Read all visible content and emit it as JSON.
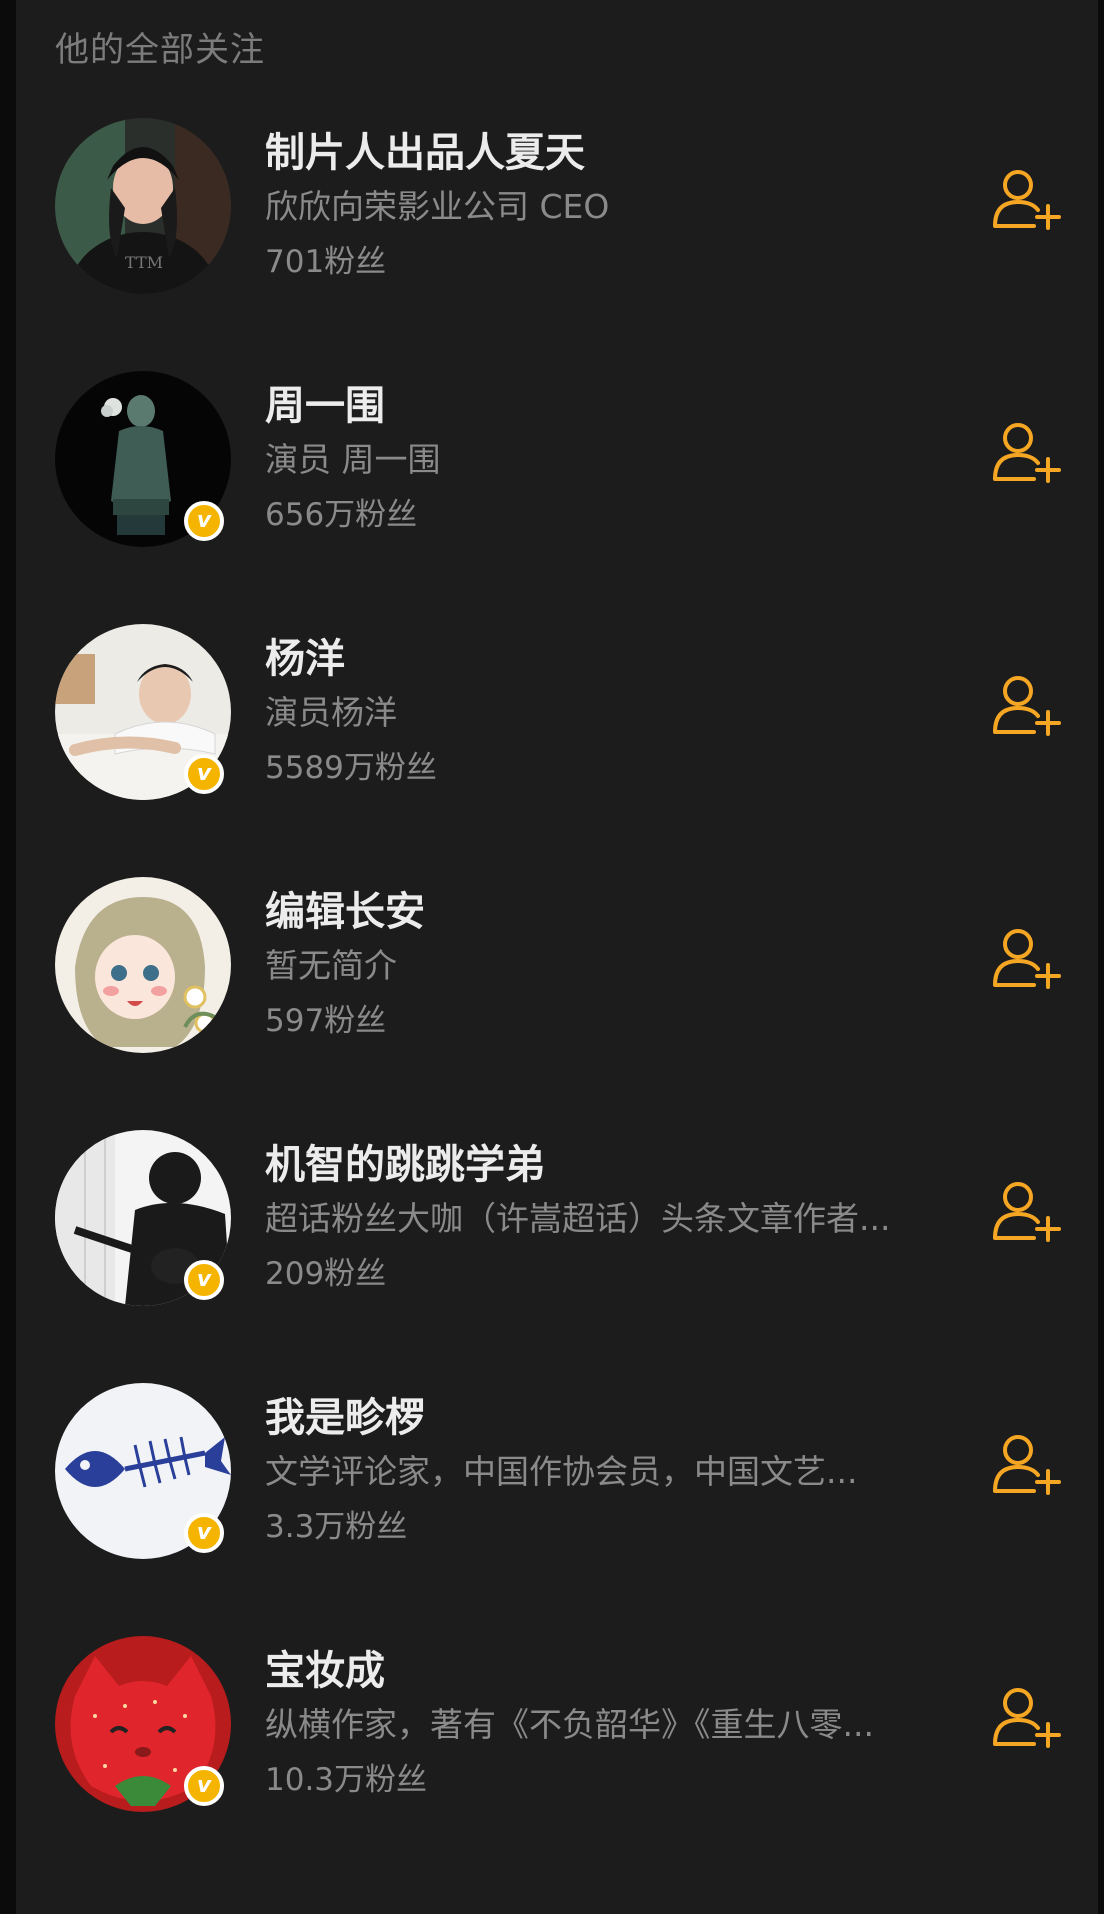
{
  "page": {
    "title": "他的全部关注"
  },
  "colors": {
    "background": "#1c1c1c",
    "outer_background": "#0b0b0b",
    "name_text": "#ececec",
    "secondary_text": "#8a8a8a",
    "accent": "#f5a623",
    "verified_badge": "#f5b400"
  },
  "follow_icon": "add-user-icon",
  "users": [
    {
      "name": "制片人出品人夏天",
      "bio": "欣欣向荣影业公司 CEO",
      "fans": "701粉丝",
      "verified": false,
      "avatar": "woman-in-cap-avatar"
    },
    {
      "name": "周一围",
      "bio": "演员 周一围",
      "fans": "656万粉丝",
      "verified": true,
      "avatar": "jade-statue-avatar"
    },
    {
      "name": "杨洋",
      "bio": "演员杨洋",
      "fans": "5589万粉丝",
      "verified": true,
      "avatar": "man-portrait-avatar"
    },
    {
      "name": "编辑长安",
      "bio": "暂无简介",
      "fans": "597粉丝",
      "verified": false,
      "avatar": "cartoon-girl-avatar"
    },
    {
      "name": "机智的跳跳学弟",
      "bio": "超话粉丝大咖（许嵩超话）头条文章作者...",
      "fans": "209粉丝",
      "verified": true,
      "avatar": "guitar-silhouette-avatar"
    },
    {
      "name": "我是畛椤",
      "bio": "文学评论家，中国作协会员，中国文艺...",
      "fans": "3.3万粉丝",
      "verified": true,
      "avatar": "fish-skeleton-avatar"
    },
    {
      "name": "宝妆成",
      "bio": "纵横作家，著有《不负韶华》《重生八零...",
      "fans": "10.3万粉丝",
      "verified": true,
      "avatar": "strawberry-cat-avatar"
    }
  ]
}
